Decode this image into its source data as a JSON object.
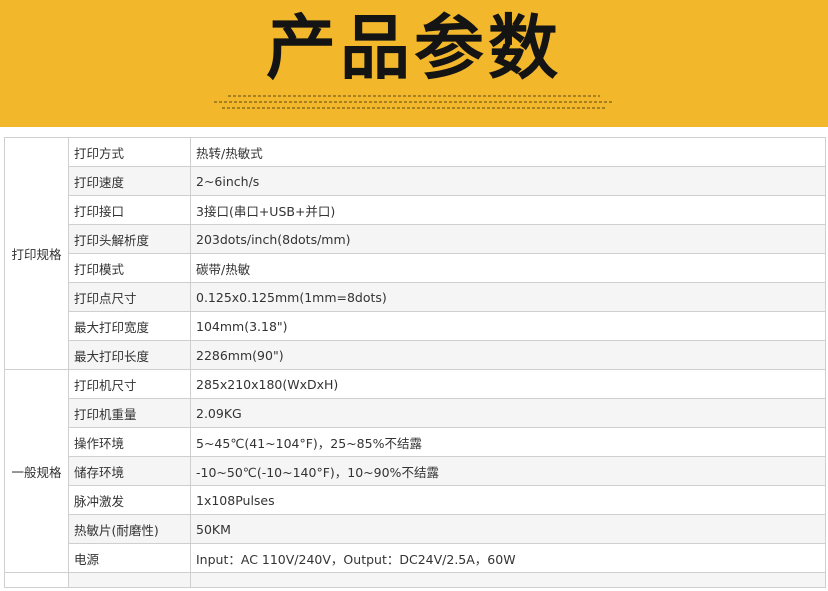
{
  "banner": {
    "title": "产品参数"
  },
  "groups": [
    {
      "name": "打印规格",
      "rows": [
        {
          "label": "打印方式",
          "value": "热转/热敏式"
        },
        {
          "label": "打印速度",
          "value": "2~6inch/s"
        },
        {
          "label": "打印接口",
          "value": "3接口(串口+USB+并口)"
        },
        {
          "label": "打印头解析度",
          "value": "203dots/inch(8dots/mm)"
        },
        {
          "label": "打印模式",
          "value": "碳带/热敏"
        },
        {
          "label": "打印点尺寸",
          "value": "0.125x0.125mm(1mm=8dots)"
        },
        {
          "label": "最大打印宽度",
          "value": "104mm(3.18\")"
        },
        {
          "label": "最大打印长度",
          "value": "2286mm(90\")"
        }
      ]
    },
    {
      "name": "一般规格",
      "rows": [
        {
          "label": "打印机尺寸",
          "value": "285x210x180(WxDxH)"
        },
        {
          "label": "打印机重量",
          "value": "2.09KG"
        },
        {
          "label": "操作环境",
          "value": "5~45℃(41~104°F)，25~85%不结露"
        },
        {
          "label": "储存环境",
          "value": "-10~50℃(-10~140°F)，10~90%不结露"
        },
        {
          "label": "脉冲激发",
          "value": "1x108Pulses"
        },
        {
          "label": "热敏片(耐磨性)",
          "value": "50KM"
        },
        {
          "label": "电源",
          "value": "Input：AC 110V/240V，Output：DC24V/2.5A，60W"
        }
      ]
    }
  ]
}
